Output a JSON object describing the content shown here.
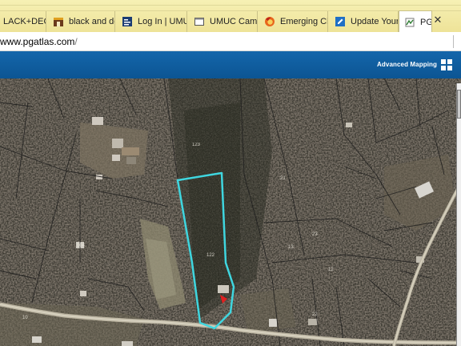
{
  "browser": {
    "tabs": [
      {
        "label": "LACK+DECKEF",
        "icon": "none"
      },
      {
        "label": "black and deck",
        "icon": "store-icon"
      },
      {
        "label": "Log In | UMUC",
        "icon": "doc-icon"
      },
      {
        "label": "UMUC Campus",
        "icon": "page-icon"
      },
      {
        "label": "Emerging Challe",
        "icon": "firefox-icon"
      },
      {
        "label": "Update Your Lis",
        "icon": "edit-icon"
      },
      {
        "label": "PGAtlas",
        "icon": "pgatlas-icon"
      }
    ],
    "close_glyph": "✕",
    "url_host": "www.pgatlas.com",
    "url_path": "/"
  },
  "app": {
    "header_color": "#0f5ea1",
    "advanced_mapping_label": "Advanced Mapping",
    "menu_icon": "grid-icon"
  },
  "map": {
    "imagery": "aerial",
    "highlight_color": "#3fd6df",
    "parcel_labels": [
      "123",
      "21",
      "122",
      "23",
      "12",
      "13",
      "104",
      "10",
      "22"
    ],
    "road_label": "",
    "marker_color": "#e02020"
  }
}
